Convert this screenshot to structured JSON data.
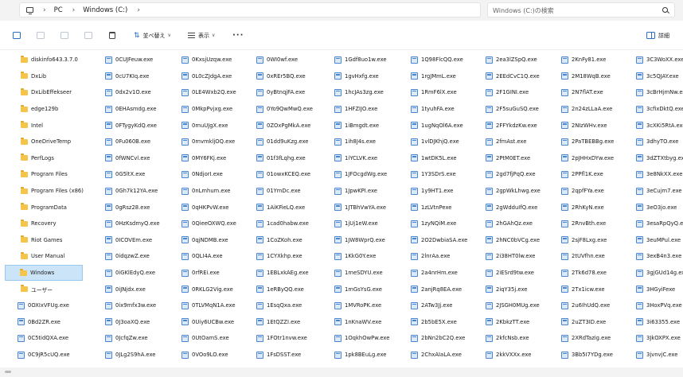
{
  "address": {
    "crumbs": [
      "PC",
      "Windows (C:)"
    ],
    "separator": "›"
  },
  "search": {
    "placeholder": "Windows (C:)の検索"
  },
  "toolbar": {
    "sort_label": "並べ替え",
    "view_label": "表示",
    "details_label": "詳細",
    "more_label": "···"
  },
  "folders": [
    "diskinfo643.3.7.0",
    "DxLib",
    "DxLibEffekseer",
    "edge129b",
    "Intel",
    "OneDriveTemp",
    "PerfLogs",
    "Program Files",
    "Program Files (x86)",
    "ProgramData",
    "Recovery",
    "Riot Games",
    "User Manual",
    "Windows",
    "ユーザー"
  ],
  "selected_folder": "Windows",
  "col1_files": [
    "0OXIxVFUg.exe",
    "0Bd2ZR.exe",
    "0C5tidQXA.exe",
    "0C9jR5cUQ.exe"
  ],
  "columns": [
    [
      "0CUJFeuw.exe",
      "0cU7KIq.exe",
      "0dx2v1O.exe",
      "0EHAsmdg.exe",
      "0FTygyKdQ.exe",
      "0Fu060B.exe",
      "0fWNCvl.exe",
      "0G5ltX.exe",
      "0Gh7k12YA.exe",
      "0gRsz28.exe",
      "0HzKsdmyQ.exe",
      "0ICOVEm.exe",
      "0idqzwZ.exe",
      "0iGKlEdyQ.exe",
      "0iJNjdx.exe",
      "0ix9mfx3w.exe",
      "0J3oaXQ.exe",
      "0JcfqZw.exe",
      "0JLg2S9hA.exe"
    ],
    [
      "0KxsjUzqw.exe",
      "0L0cZJdgA.exe",
      "0LE4Wxb2Q.exe",
      "0MkpPvjxg.exe",
      "0muUJgX.exe",
      "0mvmkljOQ.exe",
      "0MY6FKj.exe",
      "0NdjorI.exe",
      "0nLmhum.exe",
      "0qHKPvW.exe",
      "0QieeOXWQ.exe",
      "0qjNDMB.exe",
      "0QLI4A.exe",
      "0rfREi.exe",
      "0RKLG2Vig.exe",
      "0TLVMqN1A.exe",
      "0Uiy6UCBw.exe",
      "0UtOamS.exe",
      "0VOo9LO.exe"
    ],
    [
      "0WI0wf.exe",
      "0xREr5BQ.exe",
      "0yBtnqjFA.exe",
      "0Yo9QwMwQ.exe",
      "0ZOxPgMkA.exe",
      "01dd9uKzg.exe",
      "01f3fLqhg.exe",
      "01owxKCEQ.exe",
      "01YmDc.exe",
      "1AiKFieLQ.exe",
      "1cad0habw.exe",
      "1CoZKoh.exe",
      "1CYXkhp.exe",
      "1EBLxkAEg.exe",
      "1eRByQQ.exe",
      "1EsqQxa.exe",
      "1EtQZZI.exe",
      "1FOtr1nvw.exe",
      "1FsDSST.exe"
    ],
    [
      "1Gdf8uo1w.exe",
      "1gvHxfg.exe",
      "1hcJAs3zg.exe",
      "1HFZIJO.exe",
      "1iBmgdt.exe",
      "1ih8J4s.exe",
      "1iYCLVK.exe",
      "1JFOcgdWg.exe",
      "1JpwKPI.exe",
      "1JTBhVwYA.exe",
      "1jUj1eW.exe",
      "1JW8WprQ.exe",
      "1KkG0Y.exe",
      "1meSDYU.exe",
      "1mGsYsG.exe",
      "1MVRoPK.exe",
      "1nKnaWV.exe",
      "1OqkhOwPw.exe",
      "1pk8BEuLg.exe"
    ],
    [
      "1Q98FlcQQ.exe",
      "1rgJMmL.exe",
      "1RmF6lX.exe",
      "1tyuhFA.exe",
      "1ugNqOl6A.exe",
      "1vlDJKhjQ.exe",
      "1wtDK5L.exe",
      "1Y3SDrS.exe",
      "1y9HT1.exe",
      "1zLVtnPexe",
      "1zyNQiM.exe",
      "2O2DwbiaSA.exe",
      "2lnrAa.exe",
      "2a4nrHm.exe",
      "2anjRq8EA.exe",
      "2ATw3Jj.exe",
      "2b5bE5X.exe",
      "2bNn2bC2Q.exe",
      "2ChxAIaLA.exe"
    ],
    [
      "2ea3lZSpQ.exe",
      "2EEdCvC1Q.exe",
      "2F1GINI.exe",
      "2F5suGuSQ.exe",
      "2FFYkdzKw.exe",
      "2fmAst.exe",
      "2PtM0ET.exe",
      "2gd7fjPqQ.exe",
      "2gpWkLhwg.exe",
      "2gWdduIfQ.exe",
      "2hGAhQz.exe",
      "2hNC0bVCg.exe",
      "2i38HT0lw.exe",
      "2iESrd9tw.exe",
      "2iqY35j.exe",
      "2JSGH0MUg.exe",
      "2KbkzTT.exe",
      "2kfcNsb.exe",
      "2kkVXXx.exe"
    ],
    [
      "2KnFy81.exe",
      "2M18WqB.exe",
      "2N7flAT.exe",
      "2n24zLLaA.exe",
      "2NIzWHv.exe",
      "2PaTBEBBg.exe",
      "2pJHHxDYw.exe",
      "2PPfl1K.exe",
      "2qpfFYa.exe",
      "2RhKyN.exe",
      "2RnvBth.exe",
      "2sjF8Lxg.exe",
      "2tUVfhn.exe",
      "2Tk6d78.exe",
      "2Tx1icw.exe",
      "2u6IhUdQ.exe",
      "2uZT3ID.exe",
      "2XRdTazig.exe",
      "3Bb5I7YDg.exe"
    ],
    [
      "3C3WoXX.exe",
      "3c5QJAY.exe",
      "3cBrHjmNw.exe",
      "3cfixDktQ.exe",
      "3cXKi5RtA.exe",
      "3dhyTO.exe",
      "3dZTXtbyg.exe",
      "3e8NkXX.exe",
      "3eCujm7.exe",
      "3eO3jo.exe",
      "3esaRpQyQ.exe",
      "3euMPul.exe",
      "3exB4n3.exe",
      "3gjGUd14g.exe",
      "3HGyiFexe",
      "3HoxPVq.exe",
      "3i63355.exe",
      "3JkOXPX.exe",
      "3jvnvjC.exe"
    ]
  ]
}
